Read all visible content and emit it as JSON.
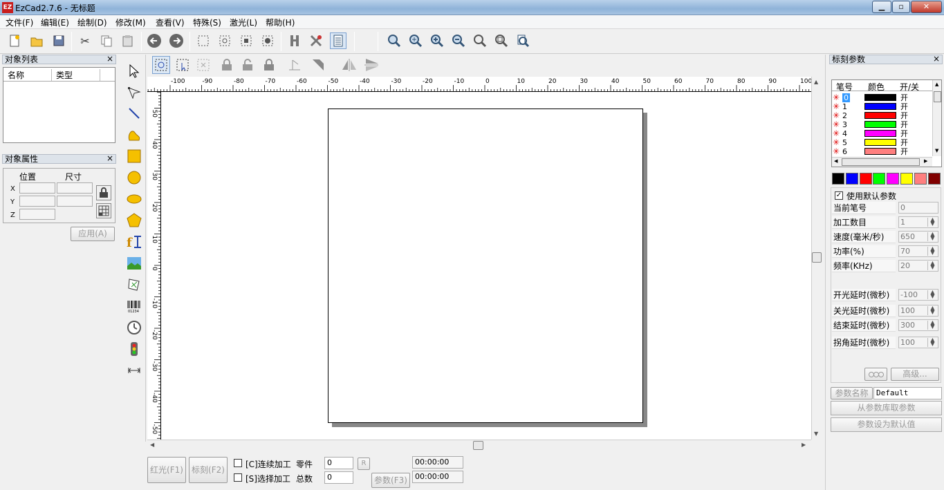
{
  "window": {
    "title": "EzCad2.7.6 - 无标题",
    "app_icon_text": "EZ",
    "minimize": "▁",
    "maximize": "▫",
    "close": "✕"
  },
  "menu": [
    "文件(F)",
    "编辑(E)",
    "绘制(D)",
    "修改(M)",
    "查看(V)",
    "特殊(S)",
    "激光(L)",
    "帮助(H)"
  ],
  "left": {
    "object_list": {
      "title": "对象列表",
      "close": "×",
      "col_name": "名称",
      "col_type": "类型"
    },
    "object_props": {
      "title": "对象属性",
      "close": "×",
      "pos": "位置",
      "size": "尺寸",
      "x": "X",
      "y": "Y",
      "z": "Z",
      "apply": "应用(A)"
    }
  },
  "ruler": {
    "h_ticks": [
      "-100",
      "-90",
      "-80",
      "-70",
      "-60",
      "-50",
      "-40",
      "-30",
      "-20",
      "-10",
      "0",
      "10",
      "20",
      "30",
      "40",
      "50",
      "60",
      "70",
      "80",
      "90",
      "100"
    ],
    "v_ticks": [
      "50",
      "40",
      "30",
      "20",
      "10",
      "0",
      "-10",
      "-20",
      "-30",
      "-40",
      "-50"
    ]
  },
  "bottom": {
    "red_light": "红光(F1)",
    "mark": "标刻(F2)",
    "continuous": "[C]连续加工",
    "select_proc": "[S]选择加工",
    "parts_label": "零件",
    "parts_value": "0",
    "total_label": "总数",
    "total_value": "0",
    "reset": "R",
    "params": "参数(F3)",
    "time1": "00:00:00",
    "time2": "00:00:00"
  },
  "right": {
    "title": "标刻参数",
    "close": "×",
    "pen_headers": [
      "笔号",
      "颜色",
      "开/关"
    ],
    "pens": [
      {
        "no": "0",
        "color": "#000000",
        "on": "开"
      },
      {
        "no": "1",
        "color": "#0000ff",
        "on": "开"
      },
      {
        "no": "2",
        "color": "#ff0000",
        "on": "开"
      },
      {
        "no": "3",
        "color": "#00ff00",
        "on": "开"
      },
      {
        "no": "4",
        "color": "#ff00ff",
        "on": "开"
      },
      {
        "no": "5",
        "color": "#ffff00",
        "on": "开"
      },
      {
        "no": "6",
        "color": "#ff7f7f",
        "on": "开"
      }
    ],
    "palette": [
      "#000000",
      "#0000ff",
      "#ff0000",
      "#00ff00",
      "#ff00ff",
      "#ffff00",
      "#ff7f7f",
      "#800000"
    ],
    "use_default": "使用默认参数",
    "params": [
      {
        "label": "当前笔号",
        "value": "0",
        "spin": false
      },
      {
        "label": "加工数目",
        "value": "1",
        "spin": true
      },
      {
        "label": "速度(毫米/秒)",
        "value": "650",
        "spin": true
      },
      {
        "label": "功率(%)",
        "value": "70",
        "spin": true
      },
      {
        "label": "频率(KHz)",
        "value": "20",
        "spin": true
      }
    ],
    "delays": [
      {
        "label": "开光延时(微秒)",
        "value": "-100"
      },
      {
        "label": "关光延时(微秒)",
        "value": "100"
      },
      {
        "label": "结束延时(微秒)",
        "value": "300"
      },
      {
        "label": "拐角延时(微秒)",
        "value": "100"
      }
    ],
    "advanced": "高级...",
    "param_name_label": "参数名称",
    "param_name_value": "Default",
    "load_from_lib": "从参数库取参数",
    "set_default": "参数设为默认值"
  }
}
